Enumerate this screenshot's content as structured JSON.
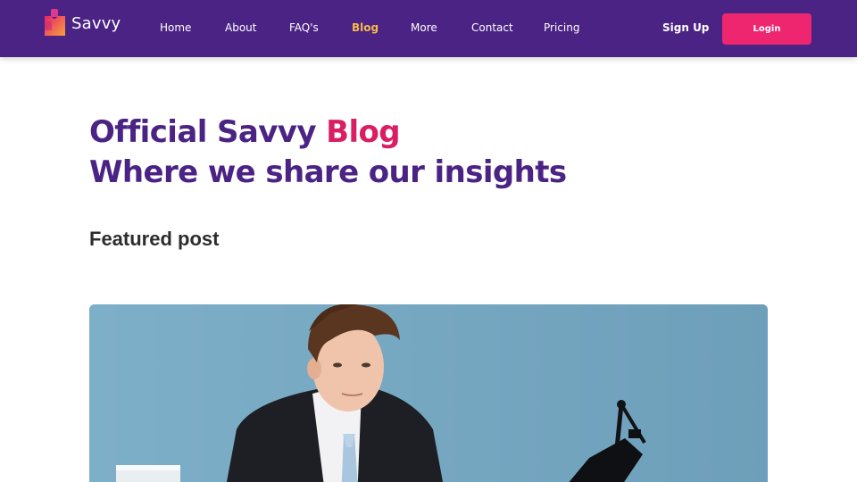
{
  "brand": {
    "name": "Savvy"
  },
  "nav": {
    "links": [
      {
        "label": "Home",
        "active": false
      },
      {
        "label": "About",
        "active": false
      },
      {
        "label": "FAQ's",
        "active": false
      },
      {
        "label": "Blog",
        "active": true
      },
      {
        "label": "More",
        "active": false
      },
      {
        "label": "Contact",
        "active": false
      },
      {
        "label": "Pricing",
        "active": false
      }
    ],
    "signup_label": "Sign Up",
    "login_label": "Login"
  },
  "hero": {
    "title_prefix": "Official Savvy ",
    "title_accent": "Blog",
    "subtitle": "Where we share our insights"
  },
  "featured": {
    "heading": "Featured post"
  },
  "colors": {
    "nav_bg": "#4b2384",
    "accent_pink": "#ee2670",
    "active_link": "#f6b94a",
    "heading_purple": "#4b2384",
    "heading_accent": "#d91e63"
  },
  "icons": {
    "logo": "puzzle-piece-logo-icon"
  }
}
